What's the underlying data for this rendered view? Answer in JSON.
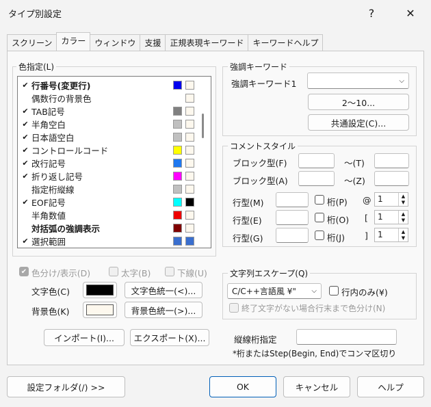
{
  "window": {
    "title": "タイプ別設定",
    "help_glyph": "?",
    "close_glyph": "✕"
  },
  "tabs": [
    {
      "label": "スクリーン"
    },
    {
      "label": "カラー"
    },
    {
      "label": "ウィンドウ"
    },
    {
      "label": "支援"
    },
    {
      "label": "正規表現キーワード"
    },
    {
      "label": "キーワードヘルプ"
    }
  ],
  "color_group": {
    "title": "色指定(L)",
    "items": [
      {
        "label": "行番号(変更行)",
        "checked": true,
        "bold": true,
        "c1": "#0000ee",
        "c2": "#fdf8ee"
      },
      {
        "label": "偶数行の背景色",
        "checked": false,
        "bold": false,
        "c1": null,
        "c2": "#fdf8ee"
      },
      {
        "label": "TAB記号",
        "checked": true,
        "bold": false,
        "c1": "#808080",
        "c2": "#fdf8ee"
      },
      {
        "label": "半角空白",
        "checked": true,
        "bold": false,
        "c1": "#c0c0c0",
        "c2": "#fdf8ee"
      },
      {
        "label": "日本語空白",
        "checked": true,
        "bold": false,
        "c1": "#c0c0c0",
        "c2": "#fdf8ee"
      },
      {
        "label": "コントロールコード",
        "checked": true,
        "bold": false,
        "c1": "#ffff00",
        "c2": "#fdf8ee"
      },
      {
        "label": "改行記号",
        "checked": true,
        "bold": false,
        "c1": "#1e78f0",
        "c2": "#fdf8ee"
      },
      {
        "label": "折り返し記号",
        "checked": true,
        "bold": false,
        "c1": "#ff00ff",
        "c2": "#fdf8ee"
      },
      {
        "label": "指定桁縦線",
        "checked": false,
        "bold": false,
        "c1": "#c0c0c0",
        "c2": "#fdf8ee"
      },
      {
        "label": "EOF記号",
        "checked": true,
        "bold": false,
        "c1": "#00ffff",
        "c2": "#000000"
      },
      {
        "label": "半角数値",
        "checked": false,
        "bold": false,
        "c1": "#ee0000",
        "c2": "#fdf8ee"
      },
      {
        "label": "対括弧の強調表示",
        "checked": false,
        "bold": true,
        "c1": "#800000",
        "c2": "#fdf8ee"
      },
      {
        "label": "選択範囲",
        "checked": true,
        "bold": false,
        "c1": "#3a6fcf",
        "c2": "#3a6fcf"
      }
    ],
    "check_glyph": "✔",
    "opt_color_display": "色分け/表示(D)",
    "opt_bold": "太字(B)",
    "opt_underline": "下線(U)",
    "text_color_label": "文字色(C)",
    "bg_color_label": "背景色(K)",
    "text_color_value": "#000000",
    "bg_color_value": "#fdf8ee",
    "unify_text": "文字色統一(<)...",
    "unify_bg": "背景色統一(>)..."
  },
  "import_button": "インポート(I)...",
  "export_button": "エクスポート(X)...",
  "emphasis": {
    "title": "強調キーワード",
    "kw1_label": "強調キーワード1",
    "kw1_value": "",
    "range_button": "2〜10...",
    "common_button": "共通設定(C)..."
  },
  "comment": {
    "title": "コメントスタイル",
    "block_f": "ブロック型(F)",
    "tilde_t": "〜(T)",
    "block_a": "ブロック型(A)",
    "tilde_z": "〜(Z)",
    "line_m": "行型(M)",
    "line_e": "行型(E)",
    "line_g": "行型(G)",
    "col_p": "桁(P)",
    "col_o": "桁(O)",
    "col_j": "桁(J)",
    "at_p": "@",
    "at_o": "[",
    "at_j": "]",
    "spin_p": "1",
    "spin_o": "1",
    "spin_j": "1"
  },
  "escape": {
    "title": "文字列エスケープ(Q)",
    "combo_value": "C/C++言語風 ¥\"",
    "line_only": "行内のみ(¥)",
    "eol_color": "終了文字がない場合行末まで色分け(N)"
  },
  "vertical_lines": {
    "label": "縦線桁指定",
    "value": "",
    "note": "*桁またはStep(Begin, End)でコンマ区切り"
  },
  "bottom": {
    "folder_button": "設定フォルダ(/) >>",
    "ok_button": "OK",
    "cancel_button": "キャンセル",
    "help_button": "ヘルプ"
  }
}
